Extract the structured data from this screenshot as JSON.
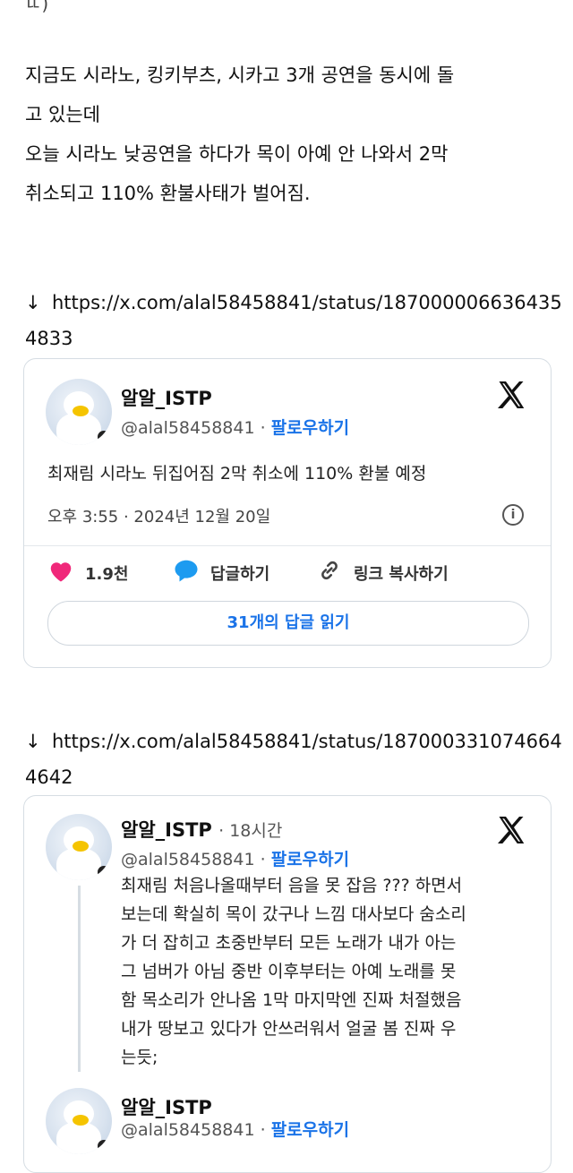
{
  "top_fragment": "ㄸ)",
  "intro": {
    "line1": "지금도 시라노, 킹키부츠, 시카고 3개 공연을 동시에 돌",
    "line2": "고 있는데",
    "line3": "오늘 시라노 낮공연을 하다가 목이 아예 안 나와서 2막",
    "line4": "취소되고 110% 환불사태가 벌어짐."
  },
  "link1": {
    "arrow": "↓",
    "url": "https://x.com/alal58458841/status/1870000066364354833"
  },
  "tweet1": {
    "name": "알알_ISTP",
    "handle": "@alal58458841",
    "separator": "·",
    "follow": "팔로우하기",
    "text": "최재림 시라노 뒤집어짐 2막 취소에 110% 환불 예정",
    "timestamp": "오후 3:55 · 2024년 12월 20일",
    "likes": "1.9천",
    "reply_label": "답글하기",
    "copy_label": "링크 복사하기",
    "read_replies": "31개의 답글 읽기",
    "info_glyph": "i"
  },
  "link2": {
    "arrow": "↓",
    "url": "https://x.com/alal58458841/status/1870003310746644642"
  },
  "tweet2": {
    "name": "알알_ISTP",
    "time_ago": "· 18시간",
    "handle": "@alal58458841",
    "separator": "·",
    "follow": "팔로우하기",
    "lines": [
      "최재림 처음나올때부터 음을 못 잡음 ??? 하면서",
      "보는데 확실히 목이 갔구나 느낌 대사보다 숨소리",
      "가 더 잡히고 초중반부터 모든 노래가 내가 아는",
      "그 넘버가 아님 중반 이후부터는 아예 노래를 못",
      "함 목소리가 안나옴 1막 마지막엔 진짜 처절했음",
      "내가 땅보고 있다가 안쓰러워서 얼굴 봄 진짜 우",
      "는듯;"
    ]
  },
  "tweet3": {
    "name": "알알_ISTP",
    "handle": "@alal58458841",
    "separator": "·",
    "follow": "팔로우하기"
  }
}
